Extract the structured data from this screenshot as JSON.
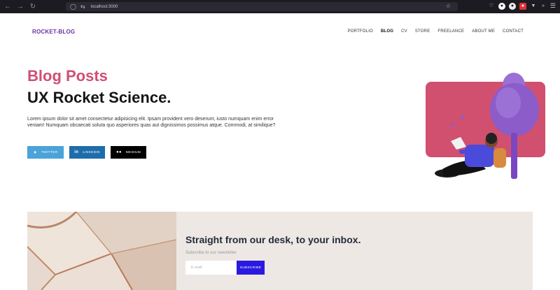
{
  "browser": {
    "url": "localhost:3000",
    "icons": [
      "back-icon",
      "forward-icon",
      "reload-icon",
      "shield-icon",
      "page-info-icon",
      "bookmark-star-icon",
      "pocket-icon",
      "extension-icon",
      "menu-icon"
    ]
  },
  "header": {
    "logo": "ROCKET-BLOG",
    "nav": [
      "PORTFOLIO",
      "BLOG",
      "CV",
      "STORE",
      "FREELANCE",
      "ABOUT ME",
      "CONTACT"
    ],
    "active": "BLOG"
  },
  "hero": {
    "title": "Blog Posts",
    "subtitle": "UX Rocket Science.",
    "text": "Lorem ipsum dolor sit amet consectetur adipisicing elit. Ipsam provident vero deserunt, iusto numquam enim error veniam! Numquam obcaecati soluta quo asperiores quas aut dignissimos possimus atque. Commodi, at similique?"
  },
  "social": {
    "twitter": "TWITTER",
    "linkedin": "LINKEDIN",
    "medium": "MEDIUM"
  },
  "newsletter": {
    "title": "Straight from our desk, to your inbox.",
    "subtitle": "Subscribe to our newsletter",
    "email_placeholder": "E-mail",
    "button": "SUBSCRIBE"
  },
  "colors": {
    "accent_pink": "#cf4f75",
    "logo_purple": "#6b2fa0",
    "subscribe_blue": "#2a1ae0",
    "twitter": "#4aa3d9",
    "linkedin": "#1f6cab",
    "medium": "#000000"
  }
}
